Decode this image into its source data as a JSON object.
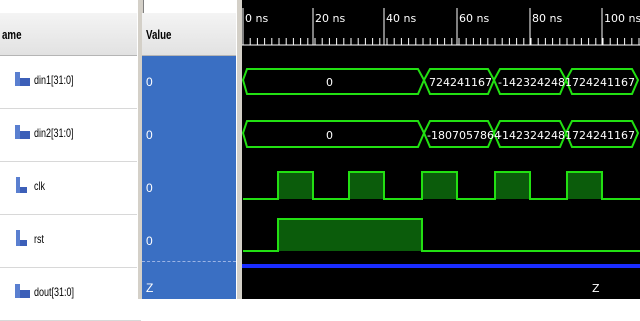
{
  "header": {
    "name_label": "ame",
    "value_label": "Value"
  },
  "signals": [
    {
      "name": "din1[31:0]",
      "value": "0",
      "icon": "bus-signal-icon"
    },
    {
      "name": "din2[31:0]",
      "value": "0",
      "icon": "bus-signal-icon"
    },
    {
      "name": "clk",
      "value": "0",
      "icon": "bit-signal-icon"
    },
    {
      "name": "rst",
      "value": "0",
      "icon": "bit-signal-icon"
    },
    {
      "name": "dout[31:0]",
      "value": "Z",
      "icon": "bus-signal-icon"
    }
  ],
  "timeline": {
    "ticks": [
      "0 ns",
      "20 ns",
      "40 ns",
      "60 ns",
      "80 ns",
      "100 ns"
    ]
  },
  "waves": {
    "din1_values": [
      "0",
      "724241167",
      "-1423242481",
      "724241167"
    ],
    "din2_values": [
      "0",
      "-1807057864",
      "-1423242481",
      "724241167"
    ],
    "dout_value": "Z"
  },
  "colors": {
    "signal": "#22e012",
    "high_fill": "#0b5c0b",
    "dout": "#1a2cff",
    "value_bg": "#3a6fc3",
    "wave_bg": "#000000"
  }
}
